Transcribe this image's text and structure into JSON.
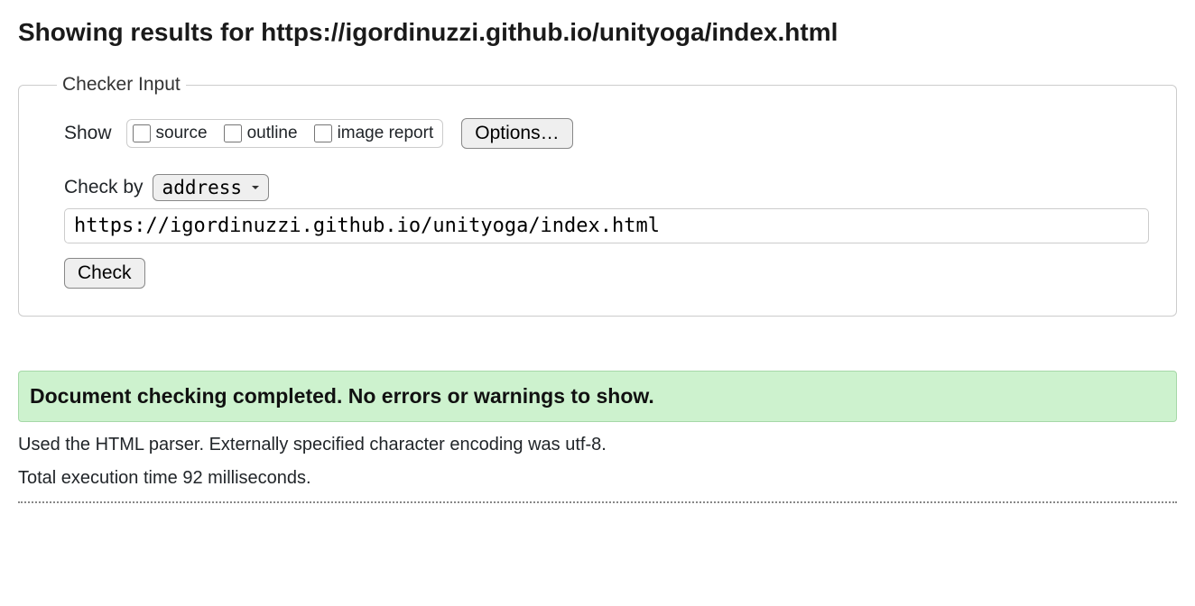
{
  "heading": "Showing results for https://igordinuzzi.github.io/unityoga/index.html",
  "checker": {
    "legend": "Checker Input",
    "show_label": "Show",
    "checkboxes": {
      "source": "source",
      "outline": "outline",
      "image_report": "image report"
    },
    "options_button": "Options…",
    "checkby_label": "Check by",
    "checkby_selected": "address",
    "address_value": "https://igordinuzzi.github.io/unityoga/index.html",
    "check_button": "Check"
  },
  "result": {
    "success_message": "Document checking completed. No errors or warnings to show.",
    "parser_info": "Used the HTML parser. Externally specified character encoding was utf-8.",
    "timing_info": "Total execution time 92 milliseconds."
  }
}
